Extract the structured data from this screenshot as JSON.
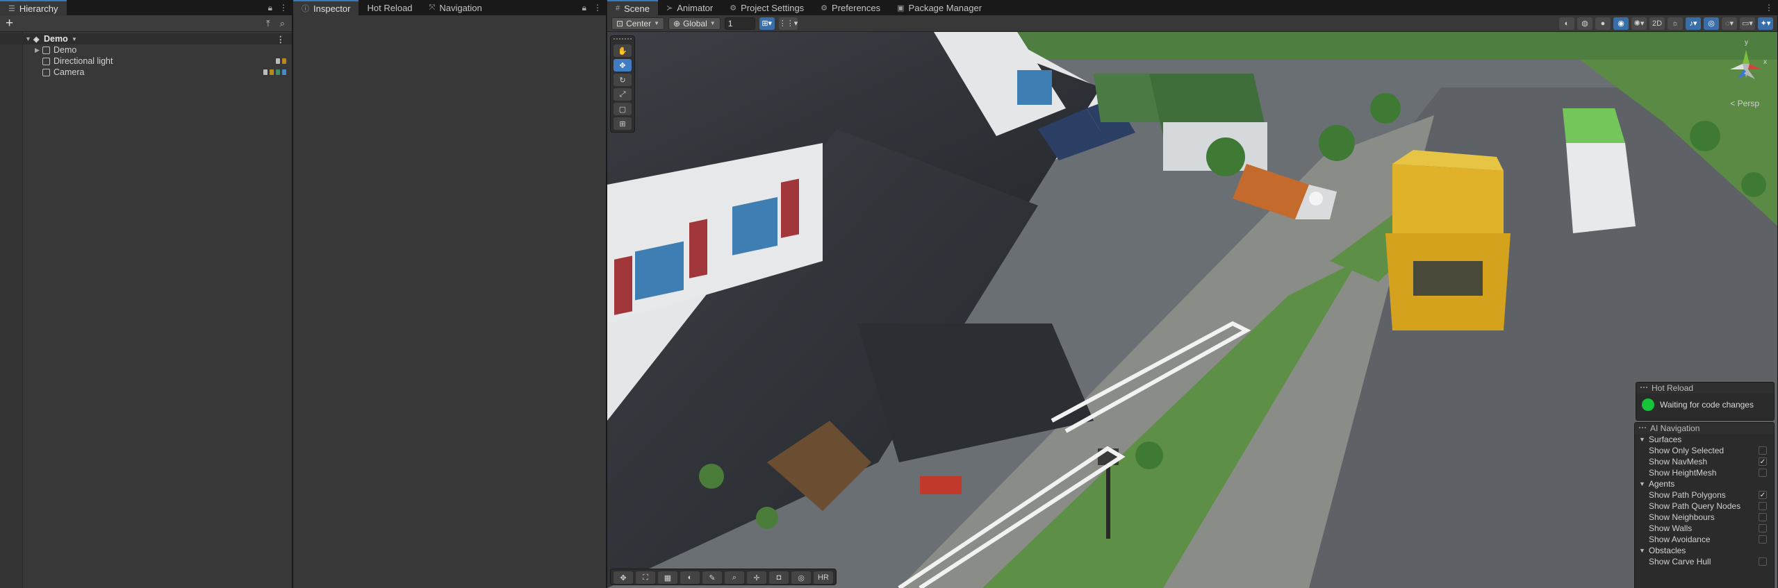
{
  "hierarchy": {
    "tab_label": "Hierarchy",
    "scene_name": "Demo",
    "items": [
      {
        "label": "Demo"
      },
      {
        "label": "Directional light"
      },
      {
        "label": "Camera"
      }
    ]
  },
  "inspector": {
    "tabs": [
      {
        "label": "Inspector"
      },
      {
        "label": "Hot Reload"
      },
      {
        "label": "Navigation"
      }
    ]
  },
  "scene": {
    "tabs": [
      {
        "label": "Scene"
      },
      {
        "label": "Animator"
      },
      {
        "label": "Project Settings"
      },
      {
        "label": "Preferences"
      },
      {
        "label": "Package Manager"
      }
    ],
    "pivot_mode": "Center",
    "pivot_rotation": "Global",
    "grid_snap_value": "1",
    "camera_mode": "< Persp",
    "bottom_tool_label": "HR"
  },
  "hot_reload_overlay": {
    "title": "Hot Reload",
    "status": "Waiting for code changes",
    "status_color": "#16c43a"
  },
  "ai_nav_overlay": {
    "title": "AI Navigation",
    "sections": [
      {
        "title": "Surfaces",
        "options": [
          {
            "label": "Show Only Selected",
            "checked": false
          },
          {
            "label": "Show NavMesh",
            "checked": true
          },
          {
            "label": "Show HeightMesh",
            "checked": false
          }
        ]
      },
      {
        "title": "Agents",
        "options": [
          {
            "label": "Show Path Polygons",
            "checked": true
          },
          {
            "label": "Show Path Query Nodes",
            "checked": false
          },
          {
            "label": "Show Neighbours",
            "checked": false
          },
          {
            "label": "Show Walls",
            "checked": false
          },
          {
            "label": "Show Avoidance",
            "checked": false
          }
        ]
      },
      {
        "title": "Obstacles",
        "options": [
          {
            "label": "Show Carve Hull",
            "checked": false
          }
        ]
      }
    ]
  },
  "colors": {
    "accent": "#3a79bb",
    "panel_bg": "#383838"
  }
}
